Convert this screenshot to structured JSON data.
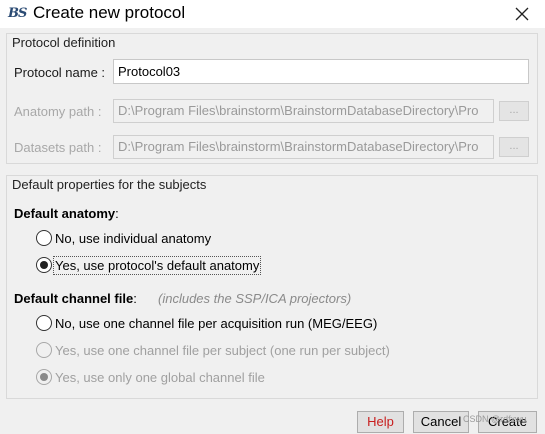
{
  "window": {
    "title": "Create new protocol",
    "app_icon_text": "BS"
  },
  "protocol_definition": {
    "title": "Protocol definition",
    "name_label": "Protocol name :",
    "name_value": "Protocol03",
    "anatomy_label": "Anatomy path :",
    "anatomy_value": "D:\\Program Files\\brainstorm\\BrainstormDatabaseDirectory\\Pro",
    "datasets_label": "Datasets path :",
    "datasets_value": "D:\\Program Files\\brainstorm\\BrainstormDatabaseDirectory\\Pro",
    "browse_label": "..."
  },
  "defaults": {
    "title": "Default properties for the subjects",
    "anatomy_heading": "Default anatomy",
    "anatomy_suffix": ":",
    "anatomy_options": [
      "No, use individual anatomy",
      "Yes, use protocol's default anatomy"
    ],
    "channel_heading": "Default channel file",
    "channel_suffix": ":",
    "channel_hint": "(includes the SSP/ICA projectors)",
    "channel_options": [
      "No, use one channel file per acquisition run (MEG/EEG)",
      "Yes, use one channel file per subject  (one run per subject)",
      "Yes, use only one global channel file"
    ]
  },
  "buttons": {
    "help": "Help",
    "cancel": "Cancel",
    "create": "Create"
  },
  "watermark": "CSDN @rdfxwu"
}
